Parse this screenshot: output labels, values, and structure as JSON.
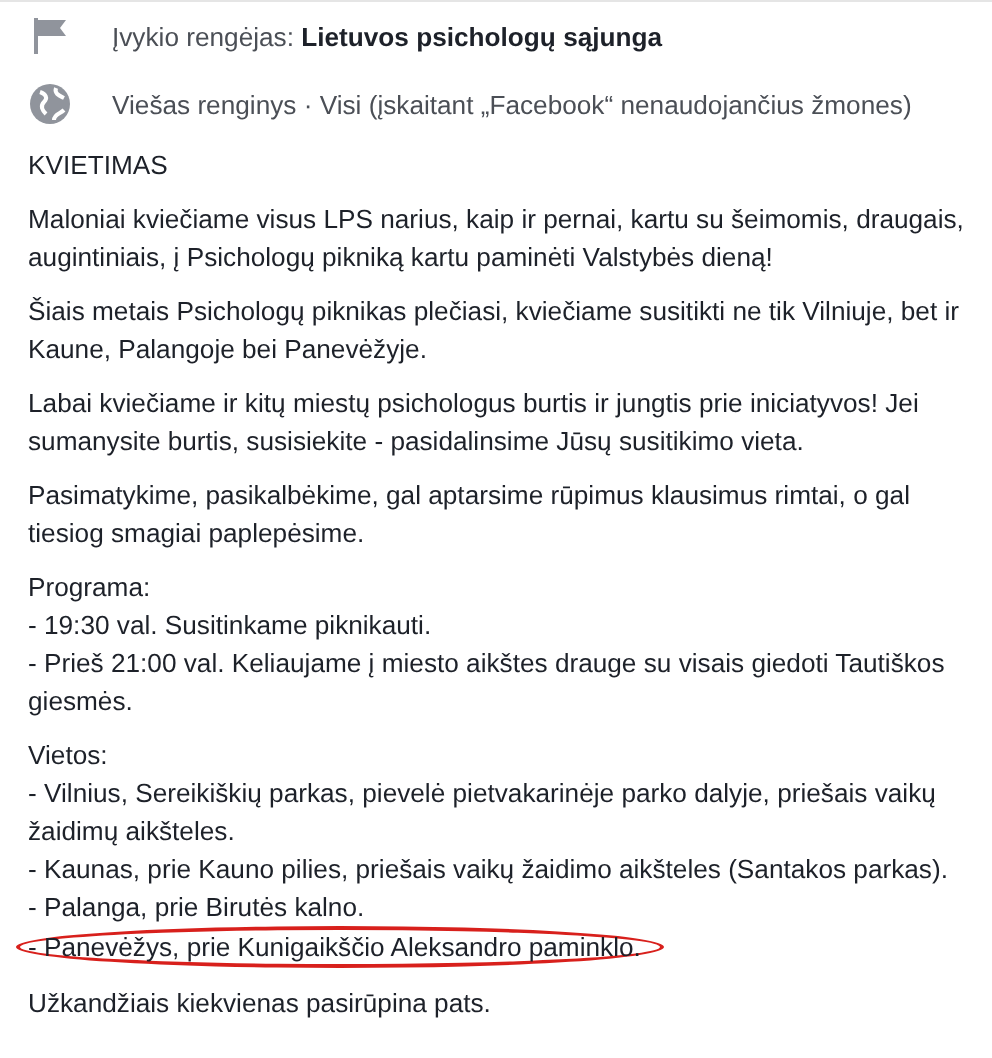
{
  "details": [
    {
      "kind": "organizer",
      "label": "Įvykio rengėjas:",
      "value": "Lietuvos psichologų sąjunga"
    },
    {
      "kind": "privacy",
      "text": "Viešas renginys · Visi (įskaitant „Facebook“ nenaudojančius žmones)"
    }
  ],
  "description": {
    "title": "KVIETIMAS",
    "blocks": [
      {
        "kind": "paragraph",
        "text": "Maloniai kviečiame visus LPS narius, kaip ir pernai, kartu su šeimomis, draugais, augintiniais, į Psichologų pikniką kartu paminėti Valstybės dieną!"
      },
      {
        "kind": "paragraph",
        "text": "Šiais metais Psichologų piknikas plečiasi, kviečiame susitikti ne tik Vilniuje, bet ir Kaune, Palangoje bei Panevėžyje."
      },
      {
        "kind": "paragraph",
        "text": "Labai kviečiame ir kitų miestų psichologus burtis ir jungtis prie iniciatyvos! Jei sumanysite burtis, susisiekite - pasidalinsime Jūsų susitikimo vieta."
      },
      {
        "kind": "paragraph",
        "text": "Pasimatykime, pasikalbėkime, gal aptarsime rūpimus klausimus rimtai, o gal tiesiog smagiai paplepėsime."
      },
      {
        "kind": "list",
        "heading": "Programa:",
        "items": [
          {
            "text": "- 19:30 val. Susitinkame piknikauti.",
            "circled": false
          },
          {
            "text": "- Prieš 21:00 val. Keliaujame į miesto aikštes drauge su visais giedoti Tautiškos giesmės.",
            "circled": false
          }
        ]
      },
      {
        "kind": "list",
        "heading": "Vietos:",
        "items": [
          {
            "text": "- Vilnius, Sereikiškių parkas, pievelė pietvakarinėje parko dalyje, priešais vaikų žaidimų aikšteles.",
            "circled": false
          },
          {
            "text": "- Kaunas, prie Kauno pilies, priešais vaikų žaidimo aikšteles (Santakos parkas).",
            "circled": false
          },
          {
            "text": "- Palanga, prie Birutės kalno.",
            "circled": false
          },
          {
            "text": "- Panevėžys, prie Kunigaikščio Aleksandro paminklo.",
            "circled": true
          }
        ]
      },
      {
        "kind": "paragraph",
        "text": "Užkandžiais kiekvienas pasirūpina pats."
      }
    ]
  }
}
